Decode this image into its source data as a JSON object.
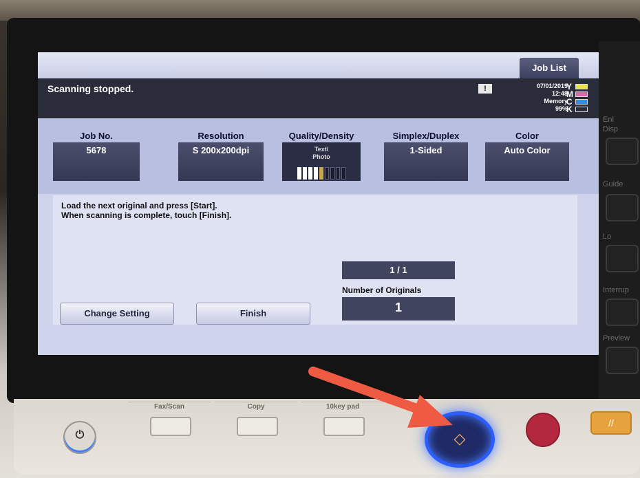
{
  "screen": {
    "job_list_tab": "Job List",
    "status_message": "Scanning stopped.",
    "alert_symbol": "!",
    "date": "07/01/2019",
    "time": "12:48",
    "memory_label": "Memory",
    "memory_percent": "99%",
    "toner": [
      {
        "letter": "Y",
        "color": "#e8e24a"
      },
      {
        "letter": "M",
        "color": "#d86aa8"
      },
      {
        "letter": "C",
        "color": "#3a8be0"
      },
      {
        "letter": "K",
        "color": "#2b2c3a"
      }
    ],
    "settings": {
      "job_no_label": "Job No.",
      "job_no_value": "5678",
      "resolution_label": "Resolution",
      "resolution_value": "S 200x200dpi",
      "quality_label": "Quality/Density",
      "quality_value_line1": "Text/",
      "quality_value_line2": "Photo",
      "density_level": 5,
      "density_steps": 9,
      "simplex_label": "Simplex/Duplex",
      "simplex_value": "1-Sided",
      "color_label": "Color",
      "color_value": "Auto Color"
    },
    "instruction_line1": "Load the next original and press [Start].",
    "instruction_line2": "When scanning is complete, touch [Finish].",
    "page_counter": "1 / 1",
    "originals_label": "Number of Originals",
    "originals_value": "1",
    "change_setting_button": "Change Setting",
    "finish_button": "Finish"
  },
  "side_panel": {
    "labels": [
      "Enl",
      "Disp",
      "Guide",
      "Lo",
      "Interrup",
      "Preview"
    ]
  },
  "console": {
    "tabs": [
      "Fax/Scan",
      "Copy",
      "10key pad"
    ],
    "reset_glyph": "//"
  },
  "colors": {
    "start_glow": "#2b5dff",
    "annotation_arrow": "#ef5a43",
    "stop_button": "#b3283f",
    "reset_button": "#e6a23c"
  }
}
